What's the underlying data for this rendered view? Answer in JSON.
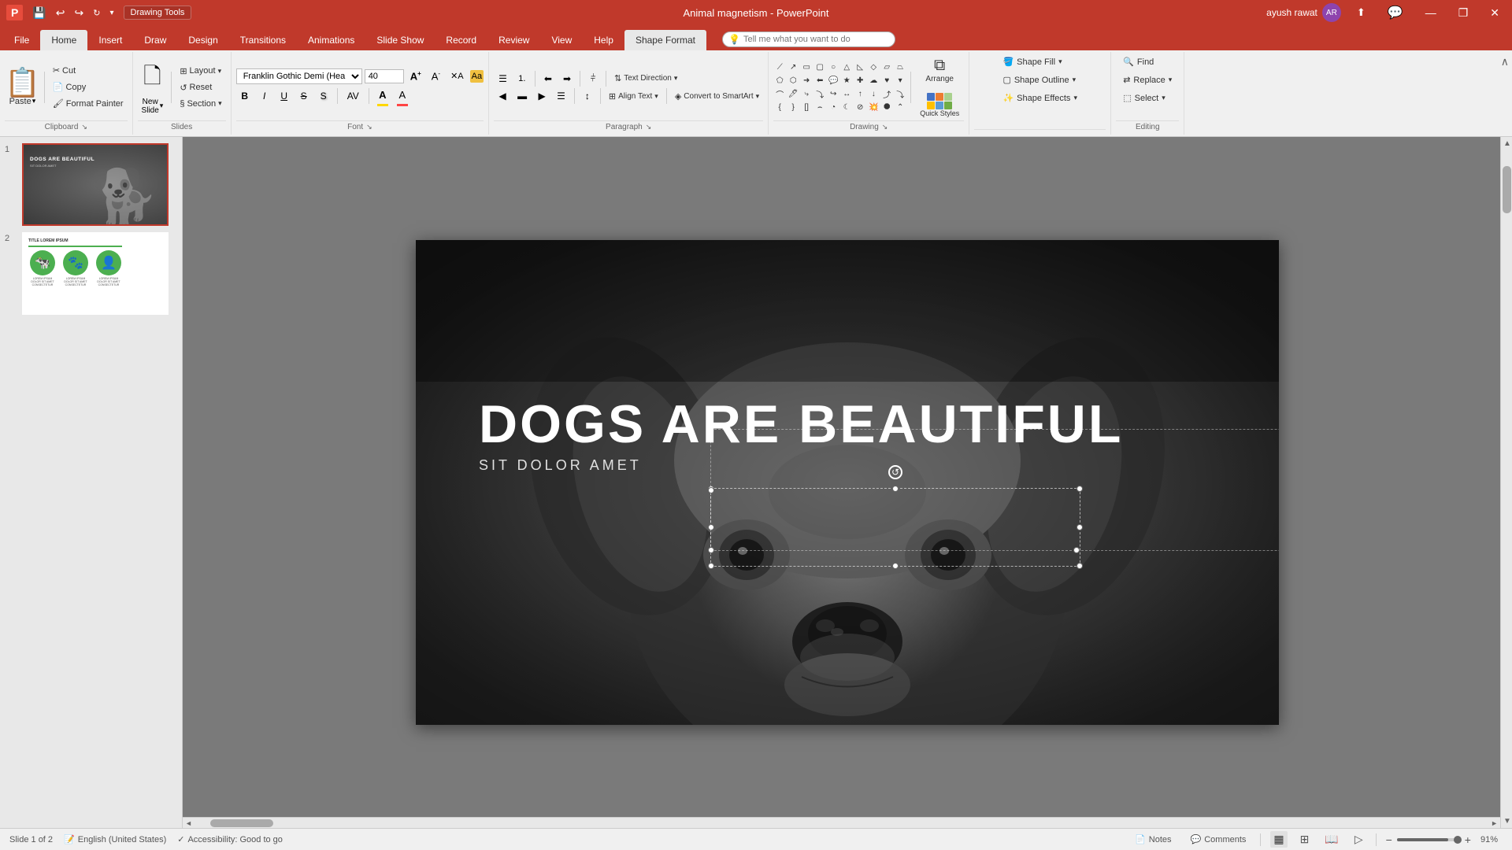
{
  "app": {
    "title": "Animal magnetism - PowerPoint",
    "drawing_tools_label": "Drawing Tools"
  },
  "titlebar": {
    "save_icon": "💾",
    "undo_icon": "↩",
    "redo_icon": "↪",
    "customize_icon": "▼",
    "minimize_icon": "—",
    "restore_icon": "❐",
    "close_icon": "✕",
    "user_name": "ayush rawat",
    "profile_icon": "👤"
  },
  "ribbon_tabs": [
    {
      "label": "File",
      "id": "file"
    },
    {
      "label": "Home",
      "id": "home",
      "active": true
    },
    {
      "label": "Insert",
      "id": "insert"
    },
    {
      "label": "Draw",
      "id": "draw"
    },
    {
      "label": "Design",
      "id": "design"
    },
    {
      "label": "Transitions",
      "id": "transitions"
    },
    {
      "label": "Animations",
      "id": "animations"
    },
    {
      "label": "Slide Show",
      "id": "slideshow"
    },
    {
      "label": "Record",
      "id": "record"
    },
    {
      "label": "Review",
      "id": "review"
    },
    {
      "label": "View",
      "id": "view"
    },
    {
      "label": "Help",
      "id": "help"
    },
    {
      "label": "Shape Format",
      "id": "shapeformat",
      "active": true
    }
  ],
  "ribbon": {
    "clipboard": {
      "group_label": "Clipboard",
      "paste_label": "Paste",
      "cut_label": "Cut",
      "copy_label": "Copy",
      "format_painter_label": "Format Painter"
    },
    "slides": {
      "group_label": "Slides",
      "new_slide_label": "New\nSlide",
      "layout_label": "Layout",
      "reset_label": "Reset",
      "section_label": "Section"
    },
    "font": {
      "group_label": "Font",
      "font_name": "Franklin Gothic Demi (Hea...",
      "font_size": "40",
      "bold_label": "B",
      "italic_label": "I",
      "underline_label": "U",
      "strikethrough_label": "S",
      "shadow_label": "S",
      "char_spacing_label": "AV",
      "font_color_label": "A",
      "highlight_label": "A",
      "increase_size": "A↑",
      "decrease_size": "A↓",
      "clear_format": "✕A"
    },
    "paragraph": {
      "group_label": "Paragraph",
      "bullets_label": "☰",
      "numbering_label": "≡",
      "indent_decrease": "←",
      "indent_increase": "→",
      "align_left": "◀",
      "align_center": "▬",
      "align_right": "▶",
      "justify": "☰",
      "columns": "⫩",
      "line_spacing": "↕",
      "text_direction_label": "Text Direction",
      "align_text_label": "Align Text",
      "convert_smartart_label": "Convert to SmartArt"
    },
    "drawing": {
      "group_label": "Drawing",
      "arrange_label": "Arrange",
      "quick_styles_label": "Quick Styles"
    },
    "shapeformat": {
      "shape_fill_label": "Shape Fill",
      "shape_outline_label": "Shape Outline",
      "shape_effects_label": "Shape Effects",
      "find_label": "Find",
      "replace_label": "Replace",
      "select_label": "Select"
    },
    "editing": {
      "group_label": "Editing"
    }
  },
  "tell_me": {
    "placeholder": "Tell me what you want to do",
    "icon": "💡"
  },
  "slides": [
    {
      "number": 1,
      "title": "DOGS ARE BEAUTIFUL",
      "subtitle": "SIT DOLOR AMET",
      "active": true
    },
    {
      "number": 2,
      "title": "TITLE LOREM IPSUM",
      "active": false
    }
  ],
  "slide_content": {
    "main_title": "DOGS ARE BEAUTIFUL",
    "subtitle": "SIT DOLOR AMET"
  },
  "status_bar": {
    "slide_info": "Slide 1 of 2",
    "language": "English (United States)",
    "accessibility": "Accessibility: Good to go",
    "notes_label": "Notes",
    "comments_label": "Comments",
    "zoom_percent": "91%"
  }
}
